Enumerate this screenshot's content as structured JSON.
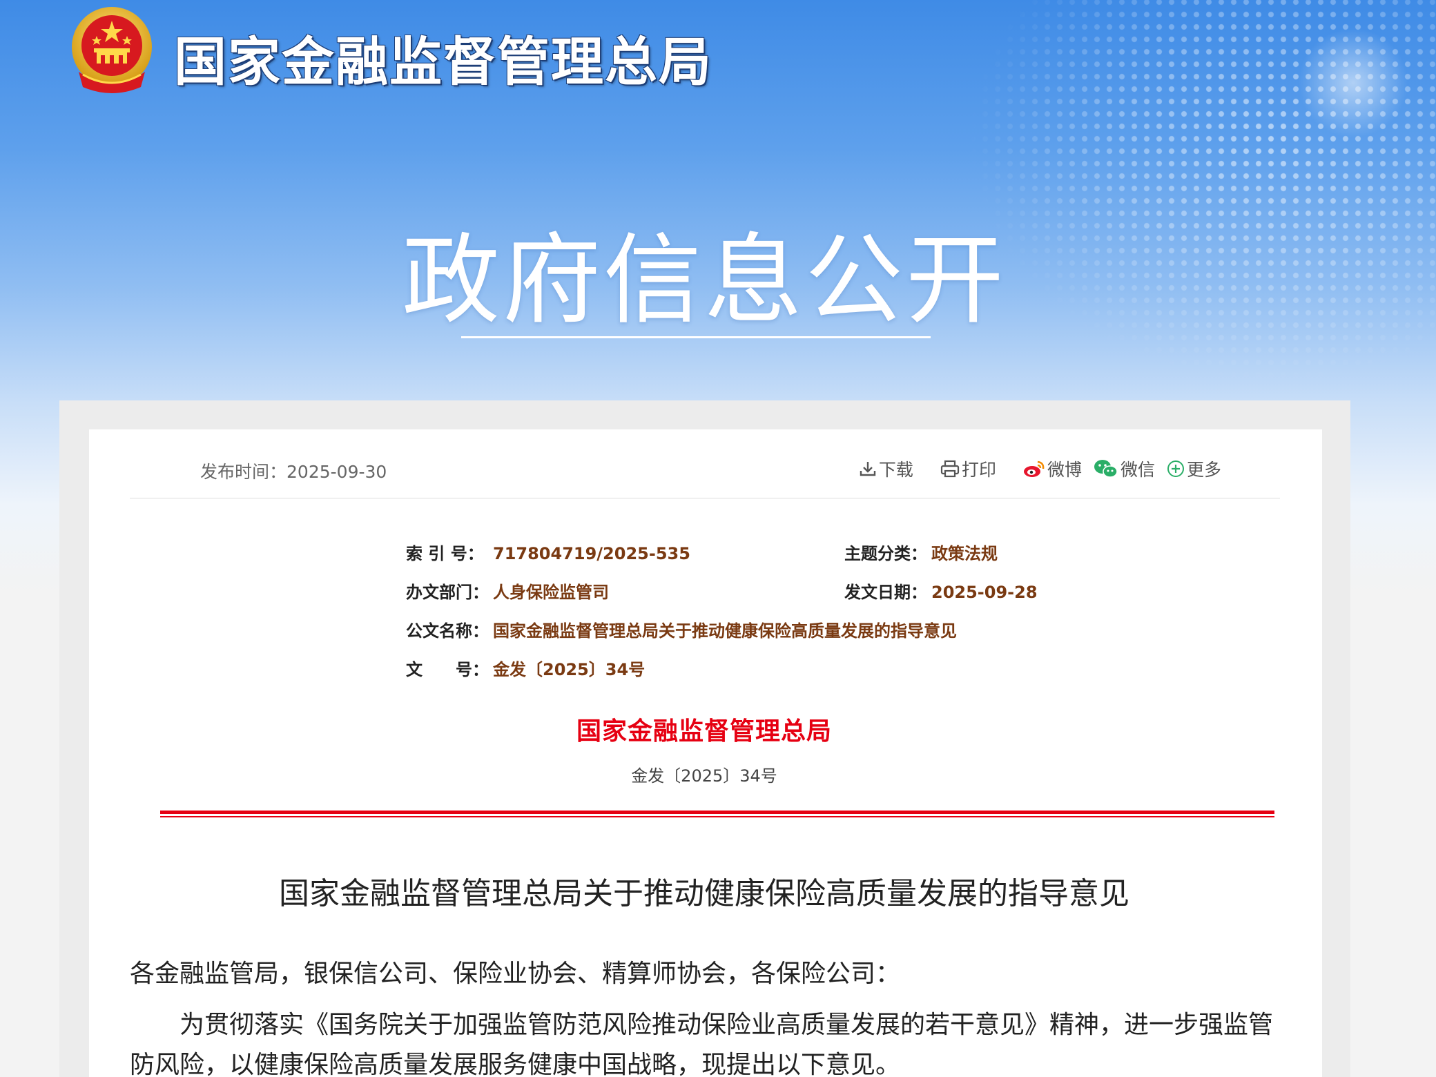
{
  "header": {
    "org_name": "国家金融监督管理总局",
    "hero_title": "政府信息公开",
    "emblem_icon": "national-emblem-icon"
  },
  "meta": {
    "publish_label": "发布时间：",
    "publish_date": "2025-09-30",
    "tools": [
      {
        "label": "下载",
        "icon": "download-icon"
      },
      {
        "label": "打印",
        "icon": "print-icon"
      },
      {
        "label": "微博",
        "icon": "weibo-icon"
      },
      {
        "label": "微信",
        "icon": "wechat-icon"
      },
      {
        "label": "更多",
        "icon": "plus-circle-icon"
      }
    ]
  },
  "info": {
    "index_label": "索 引 号：",
    "index_value": "717804719/2025-535",
    "topic_label": "主题分类：",
    "topic_value": "政策法规",
    "dept_label": "办文部门：",
    "dept_value": "人身保险监管司",
    "issue_date_label": "发文日期：",
    "issue_date_value": "2025-09-28",
    "name_label": "公文名称：",
    "name_value": "国家金融监督管理总局关于推动健康保险高质量发展的指导意见",
    "docno_label": "文　　号：",
    "docno_value": "金发〔2025〕34号"
  },
  "document": {
    "issuer": "国家金融监督管理总局",
    "doc_number": "金发〔2025〕34号",
    "title": "国家金融监督管理总局关于推动健康保险高质量发展的指导意见",
    "salutation": "各金融监管局，银保信公司、保险业协会、精算师协会，各保险公司：",
    "paragraph_1": "为贯彻落实《国务院关于加强监管防范风险推动保险业高质量发展的若干意见》精神，进一步强监管防风险，以健康保险高质量发展服务健康中国战略，现提出以下意见。"
  },
  "colors": {
    "accent_red": "#e60012",
    "value_brown": "#7a3a12",
    "banner_blue": "#3f8be6"
  }
}
